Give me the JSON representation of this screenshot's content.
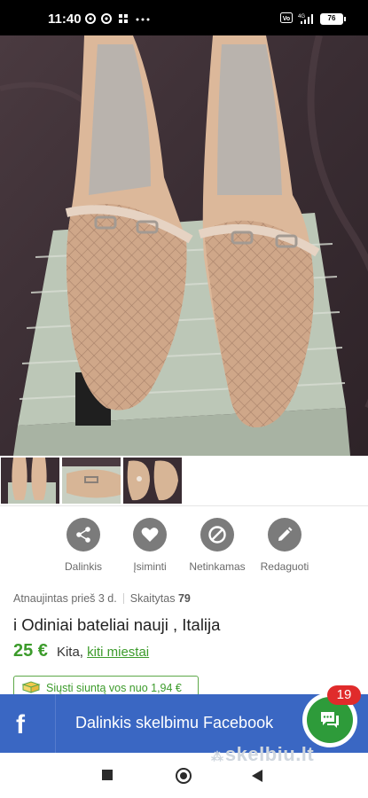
{
  "status_bar": {
    "time": "11:40",
    "battery": "76",
    "network": "4G",
    "volte": "Vo"
  },
  "photo": {
    "main_alt": "Beige leather shoes on a shoe box",
    "thumbnails": 3
  },
  "actions": [
    {
      "label": "Dalinkis",
      "icon": "share-icon"
    },
    {
      "label": "Įsiminti",
      "icon": "heart-icon"
    },
    {
      "label": "Netinkamas",
      "icon": "block-icon"
    },
    {
      "label": "Redaguoti",
      "icon": "pencil-icon"
    }
  ],
  "meta": {
    "updated": "Atnaujintas prieš 3 d.",
    "views_label": "Skaitytas",
    "views_count": "79"
  },
  "listing": {
    "title": "i Odiniai bateliai nauji , Italija",
    "price": "25 €",
    "location_prefix": "Kita,",
    "location_link": "kiti miestai"
  },
  "shipping": {
    "text": "Siųsti siuntą vos nuo 1,94 €"
  },
  "facebook_bar": {
    "logo": "f",
    "text": "Dalinkis skelbimu Facebook"
  },
  "chat": {
    "badge_count": "19"
  },
  "watermark": "skelbiu.lt",
  "colors": {
    "accent_green": "#3c9b2b",
    "facebook_blue": "#3a67c3",
    "badge_red": "#e02b2b",
    "icon_gray": "#7b7b7b"
  }
}
